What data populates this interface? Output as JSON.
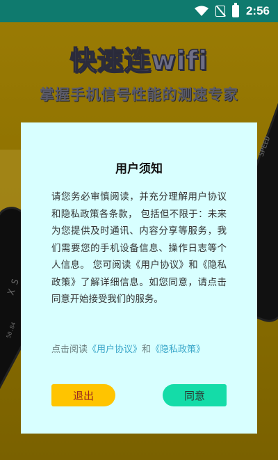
{
  "status_bar": {
    "time": "2:56",
    "icons": [
      "wifi-icon",
      "no-sim-icon",
      "battery-charging-icon"
    ],
    "color": "#0f7a6e"
  },
  "splash": {
    "title": "快速连wifi",
    "subtitle": "掌握手机信号性能的测速专家",
    "phone_texts": [
      "SPEED",
      "X S",
      "50.84"
    ]
  },
  "dialog": {
    "title": "用户须知",
    "body": "请您务必审慎阅读，并充分理解用户协议和隐私政策各条款， 包括但不限于：未来为您提供及时通讯、内容分享等服务，我们需要您的手机设备信息、操作日志等个人信息。 您可阅读《用户协议》和《隐私政策》了解详细信息。如您同意，请点击同意开始接受我们的服务。",
    "links_prefix": "点击阅读",
    "link_user_agreement": "《用户协议》",
    "links_and": "和",
    "link_privacy_policy": "《隐私政策》",
    "exit_label": "退出",
    "agree_label": "同意",
    "background": "#d8ffff",
    "exit_color": "#ffc400",
    "agree_color": "#14dca8"
  }
}
